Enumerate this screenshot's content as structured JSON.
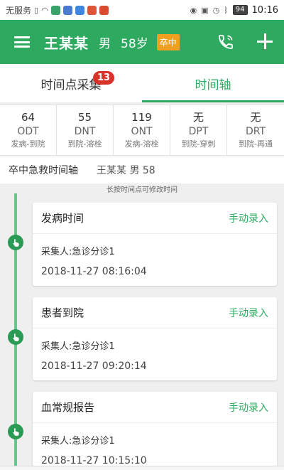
{
  "status_bar": {
    "carrier": "无服务",
    "battery": "94",
    "time": "10:16"
  },
  "app_bar": {
    "name": "王某某",
    "gender": "男",
    "age": "58岁",
    "type_badge": "卒中",
    "badge_color": "#f0a020",
    "accent": "#2daa5f"
  },
  "tabs": [
    {
      "label": "时间点采集",
      "badge": "13"
    },
    {
      "label": "时间轴"
    }
  ],
  "metrics": [
    {
      "value": "64",
      "abbr": "ODT",
      "desc": "发病-到院"
    },
    {
      "value": "55",
      "abbr": "DNT",
      "desc": "到院-溶栓"
    },
    {
      "value": "119",
      "abbr": "ONT",
      "desc": "发病-溶栓"
    },
    {
      "value": "无",
      "abbr": "DPT",
      "desc": "到院-穿刺"
    },
    {
      "value": "无",
      "abbr": "DRT",
      "desc": "到院-再通"
    }
  ],
  "timeline_header": {
    "title": "卒中急救时间轴",
    "patient": "王某某 男 58",
    "hint": "长按时间点可修改时间"
  },
  "events": [
    {
      "title": "发病时间",
      "action": "手动录入",
      "collector": "采集人:急诊分诊1",
      "time": "2018-11-27 08:16:04"
    },
    {
      "title": "患者到院",
      "action": "手动录入",
      "collector": "采集人:急诊分诊1",
      "time": "2018-11-27 09:20:14"
    },
    {
      "title": "血常规报告",
      "action": "手动录入",
      "collector": "采集人:急诊分诊1",
      "time": "2018-11-27 10:15:10"
    }
  ]
}
